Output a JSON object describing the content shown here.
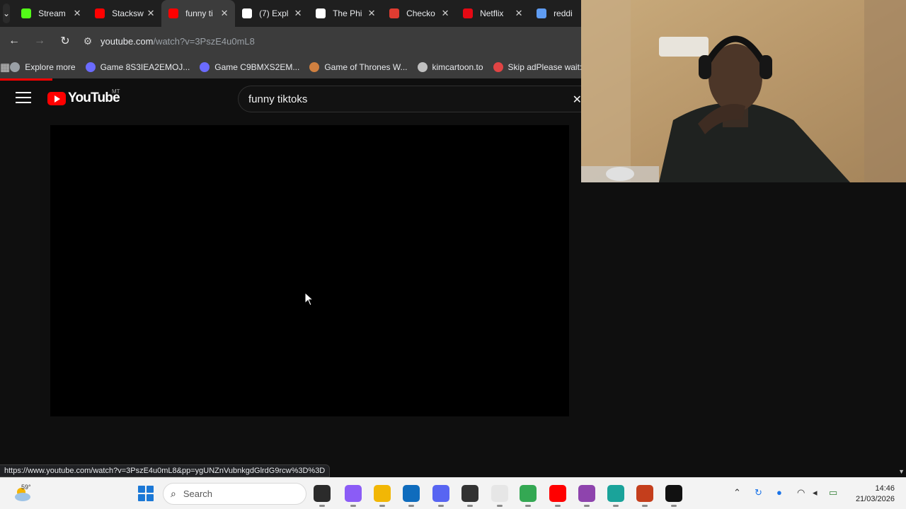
{
  "browser": {
    "tabs": [
      {
        "title": "Stream",
        "icon": "kick-icon",
        "color": "#53fc18",
        "active": false
      },
      {
        "title": "Stacksw",
        "icon": "youtube-icon",
        "color": "#ff0000",
        "active": false
      },
      {
        "title": "funny ti",
        "icon": "youtube-icon",
        "color": "#ff0000",
        "active": true
      },
      {
        "title": "(7) Expl",
        "icon": "x-icon",
        "color": "#ffffff",
        "active": false
      },
      {
        "title": "The Phi",
        "icon": "museum-icon",
        "color": "#ffffff",
        "active": false
      },
      {
        "title": "Checko",
        "icon": "s-icon",
        "color": "#e03c31",
        "active": false
      },
      {
        "title": "Netflix",
        "icon": "netflix-icon",
        "color": "#e50914",
        "active": false
      },
      {
        "title": "reddi",
        "icon": "search-icon",
        "color": "#5f9cf2",
        "active": false
      }
    ],
    "address": {
      "host": "youtube.com",
      "path": "/watch?v=3PszE4u0mL8"
    },
    "bookmarks": [
      {
        "label": "Explore more",
        "icon": "globe-icon"
      },
      {
        "label": "Game 8S3IEA2EMOJ...",
        "icon": "game-icon"
      },
      {
        "label": "Game C9BMXS2EM...",
        "icon": "game-icon"
      },
      {
        "label": "Game of Thrones W...",
        "icon": "dragon-icon"
      },
      {
        "label": "kimcartoon.to",
        "icon": "globe-icon"
      },
      {
        "label": "Skip adPlease wait:...",
        "icon": "skip-ad-icon"
      }
    ],
    "status_url": "https://www.youtube.com/watch?v=3PszE4u0mL8&pp=ygUNZnVubnkgdGlrdG9rcw%3D%3D"
  },
  "youtube": {
    "logo_text": "YouTube",
    "region": "MT",
    "search_query": "funny tiktoks",
    "load_progress": 0.09
  },
  "taskbar": {
    "weather_temp": "59°",
    "search_placeholder": "Search",
    "apps": [
      {
        "name": "task-view-icon",
        "color": "#2b2b2b"
      },
      {
        "name": "copilot-icon",
        "color": "#8b5cf6"
      },
      {
        "name": "file-explorer-icon",
        "color": "#f2b705"
      },
      {
        "name": "outlook-icon",
        "color": "#0f6cbd"
      },
      {
        "name": "discord-icon",
        "color": "#5865f2"
      },
      {
        "name": "obs-icon",
        "color": "#333333"
      },
      {
        "name": "notepad-icon",
        "color": "#e6e6e6"
      },
      {
        "name": "chrome-icon",
        "color": "#34a853"
      },
      {
        "name": "youtube-app-icon",
        "color": "#ff0000"
      },
      {
        "name": "podcast-icon",
        "color": "#8e44ad"
      },
      {
        "name": "maps-icon",
        "color": "#1aa39a"
      },
      {
        "name": "powerpoint-icon",
        "color": "#c43e1c"
      },
      {
        "name": "capcut-icon",
        "color": "#111111"
      }
    ],
    "time": "14:46",
    "date": "21/03/2026"
  }
}
